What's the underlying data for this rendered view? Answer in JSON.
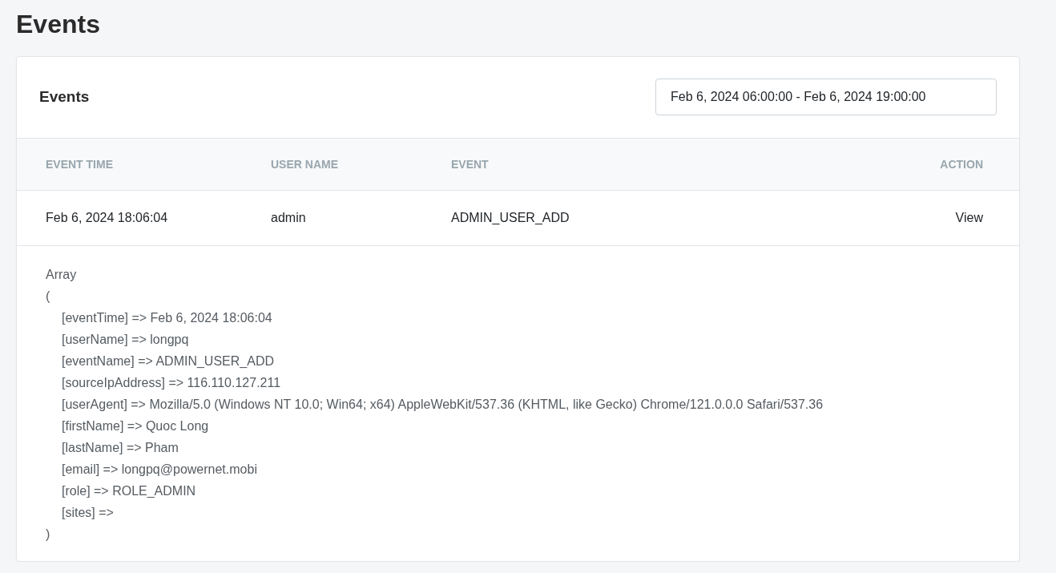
{
  "page_title": "Events",
  "card": {
    "title": "Events",
    "date_range": {
      "value": "Feb 6, 2024 06:00:00 - Feb 6, 2024 19:00:00"
    }
  },
  "table": {
    "columns": [
      "EVENT TIME",
      "USER NAME",
      "EVENT",
      "ACTION"
    ],
    "rows": [
      {
        "event_time": "Feb 6, 2024 18:06:04",
        "user_name": "admin",
        "event": "ADMIN_USER_ADD",
        "action": "View"
      }
    ]
  },
  "details": {
    "heading": "Array",
    "open": "(",
    "close": ")",
    "entries": [
      "[eventTime] => Feb 6, 2024 18:06:04",
      "[userName] => longpq",
      "[eventName] => ADMIN_USER_ADD",
      "[sourceIpAddress] => 116.110.127.211",
      "[userAgent] => Mozilla/5.0 (Windows NT 10.0; Win64; x64) AppleWebKit/537.36 (KHTML, like Gecko) Chrome/121.0.0.0 Safari/537.36",
      "[firstName] => Quoc Long",
      "[lastName] => Pham",
      "[email] => longpq@powernet.mobi",
      "[role] => ROLE_ADMIN",
      "[sites] =>"
    ]
  }
}
